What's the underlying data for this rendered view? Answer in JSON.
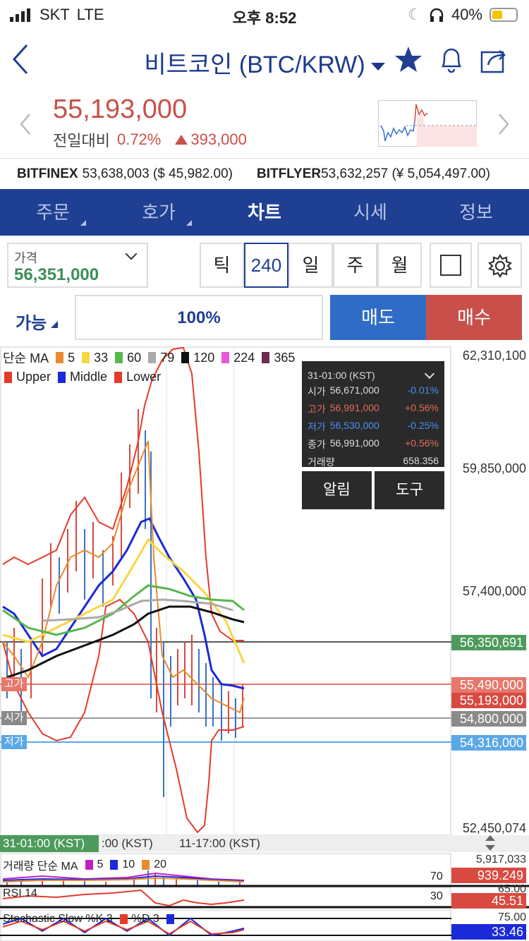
{
  "status": {
    "carrier": "SKT",
    "network": "LTE",
    "time": "오후 8:52",
    "battery": "40%"
  },
  "header": {
    "title": "비트코인 (BTC/KRW)"
  },
  "ticker": {
    "price": "55,193,000",
    "change_label": "전일대비",
    "change_pct": "0.72%",
    "change_amount": "393,000",
    "exchanges": [
      {
        "name": "BITFINEX",
        "value": "53,638,003 ($ 45,982.00)"
      },
      {
        "name": "BITFLYER",
        "value": "53,632,257 (¥ 5,054,497.00)"
      }
    ]
  },
  "tabs": [
    {
      "label": "주문",
      "active": false,
      "corner": true
    },
    {
      "label": "호가",
      "active": false,
      "corner": true
    },
    {
      "label": "차트",
      "active": true,
      "corner": false
    },
    {
      "label": "시세",
      "active": false,
      "corner": false
    },
    {
      "label": "정보",
      "active": false,
      "corner": false
    }
  ],
  "controls": {
    "price_label": "가격",
    "price_value": "56,351,000",
    "timeframes": [
      "틱",
      "240",
      "일",
      "주",
      "월"
    ],
    "active_timeframe": "240",
    "able_label": "가능",
    "percent": "100%",
    "sell_label": "매도",
    "buy_label": "매수"
  },
  "legend": {
    "ma_label": "단순 MA",
    "ma": [
      {
        "period": "5",
        "color": "#e98b2c"
      },
      {
        "period": "33",
        "color": "#f5d742"
      },
      {
        "period": "60",
        "color": "#56b84a"
      },
      {
        "period": "79",
        "color": "#aaaaaa"
      },
      {
        "period": "120",
        "color": "#111111"
      },
      {
        "period": "224",
        "color": "#e658d8"
      },
      {
        "period": "365",
        "color": "#6a2a50"
      }
    ],
    "bands": [
      {
        "name": "Upper",
        "color": "#e53a2a"
      },
      {
        "name": "Middle",
        "color": "#1a2ad8"
      },
      {
        "name": "Lower",
        "color": "#e53a2a"
      }
    ]
  },
  "axis_labels": {
    "y1": "62,310,100",
    "y2": "59,850,000",
    "y3": "57,400,000",
    "y4": "52,450,074",
    "current": "56,350,691",
    "high": "55,490,000",
    "close": "55,193,000",
    "open": "54,800,000",
    "low": "54,316,000",
    "x1": "31-01:00 (KST)",
    "x2": ":00 (KST)",
    "x3": "11-17:00 (KST)",
    "left_high": "고가",
    "left_open": "시가",
    "left_low": "저가"
  },
  "tooltip": {
    "time": "31-01:00 (KST)",
    "rows": [
      {
        "label": "시가",
        "value": "56,671,000",
        "pct": "-0.01%",
        "color": "#ddd",
        "pct_color": "#4a8ef0"
      },
      {
        "label": "고가",
        "value": "56,991,000",
        "pct": "+0.56%",
        "color": "#e56a5a",
        "pct_color": "#e56a5a"
      },
      {
        "label": "저가",
        "value": "56,530,000",
        "pct": "-0.25%",
        "color": "#4a8ef0",
        "pct_color": "#4a8ef0"
      },
      {
        "label": "종가",
        "value": "56,991,000",
        "pct": "+0.56%",
        "color": "#ddd",
        "pct_color": "#e56a5a"
      },
      {
        "label": "거래량",
        "value": "",
        "pct": "658.356",
        "color": "#ddd",
        "pct_color": "#ddd"
      }
    ],
    "alarm_label": "알림",
    "tool_label": "도구"
  },
  "volume": {
    "label": "거래량 단순 MA",
    "ma": [
      {
        "period": "5",
        "color": "#c020c0"
      },
      {
        "period": "10",
        "color": "#1a2ad8"
      },
      {
        "period": "20",
        "color": "#e98b2c"
      }
    ],
    "top": "5,917,033",
    "value": "939.249"
  },
  "rsi": {
    "label": "RSI 14",
    "level70": "70",
    "level30": "30",
    "top": "65.00",
    "value": "45.51"
  },
  "stoch": {
    "label": "Stochastic Slow %K 3",
    "d_label": "%D 3",
    "top": "75.00",
    "value": "33.46"
  }
}
